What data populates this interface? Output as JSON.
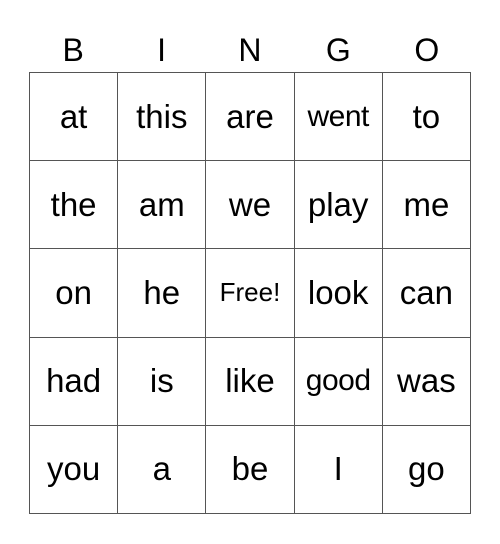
{
  "header": [
    "B",
    "I",
    "N",
    "G",
    "O"
  ],
  "rows": [
    [
      "at",
      "this",
      "are",
      "went",
      "to"
    ],
    [
      "the",
      "am",
      "we",
      "play",
      "me"
    ],
    [
      "on",
      "he",
      "Free!",
      "look",
      "can"
    ],
    [
      "had",
      "is",
      "like",
      "good",
      "was"
    ],
    [
      "you",
      "a",
      "be",
      "I",
      "go"
    ]
  ]
}
